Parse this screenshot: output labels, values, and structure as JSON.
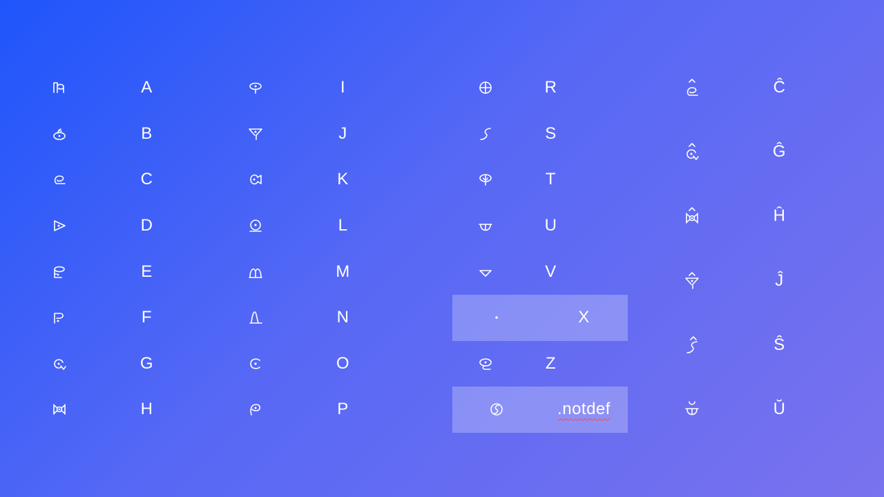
{
  "columns": [
    {
      "pairs": [
        {
          "icon": "script-glyph-a-icon",
          "letter": "A"
        },
        {
          "icon": "script-glyph-b-icon",
          "letter": "B"
        },
        {
          "icon": "script-glyph-c-icon",
          "letter": "C"
        },
        {
          "icon": "script-glyph-d-icon",
          "letter": "D"
        },
        {
          "icon": "script-glyph-e-icon",
          "letter": "E"
        },
        {
          "icon": "script-glyph-f-icon",
          "letter": "F"
        },
        {
          "icon": "script-glyph-g-icon",
          "letter": "G"
        },
        {
          "icon": "script-glyph-h-icon",
          "letter": "H"
        }
      ]
    },
    {
      "pairs": [
        {
          "icon": "script-glyph-i-icon",
          "letter": "I"
        },
        {
          "icon": "script-glyph-j-icon",
          "letter": "J"
        },
        {
          "icon": "script-glyph-k-icon",
          "letter": "K"
        },
        {
          "icon": "script-glyph-l-icon",
          "letter": "L"
        },
        {
          "icon": "script-glyph-m-icon",
          "letter": "M"
        },
        {
          "icon": "script-glyph-n-icon",
          "letter": "N"
        },
        {
          "icon": "script-glyph-o-icon",
          "letter": "O"
        },
        {
          "icon": "script-glyph-p-icon",
          "letter": "P"
        }
      ]
    },
    {
      "pairs": [
        {
          "icon": "script-glyph-r-icon",
          "letter": "R"
        },
        {
          "icon": "script-glyph-s-icon",
          "letter": "S"
        },
        {
          "icon": "script-glyph-t-icon",
          "letter": "T"
        },
        {
          "icon": "script-glyph-u-icon",
          "letter": "U"
        },
        {
          "icon": "script-glyph-v-icon",
          "letter": "V"
        },
        {
          "icon": "script-glyph-x-icon",
          "letter": "X",
          "highlighted": true
        },
        {
          "icon": "script-glyph-z-icon",
          "letter": "Z"
        },
        {
          "icon": "script-glyph-notdef-icon",
          "letter": ".notdef",
          "highlighted": true
        }
      ]
    },
    {
      "pairs": [
        {
          "icon": "script-glyph-ccirc-icon",
          "letter": "Ĉ"
        },
        {
          "icon": "script-glyph-gcirc-icon",
          "letter": "Ĝ"
        },
        {
          "icon": "script-glyph-hcirc-icon",
          "letter": "Ĥ"
        },
        {
          "icon": "script-glyph-jcirc-icon",
          "letter": "Ĵ"
        },
        {
          "icon": "script-glyph-scirc-icon",
          "letter": "Ŝ"
        },
        {
          "icon": "script-glyph-ubreve-icon",
          "letter": "Ŭ"
        }
      ]
    }
  ],
  "colors": {
    "gradient_start": "#1f55fb",
    "gradient_end": "#7a72ee",
    "highlight": "rgba(255,255,255,0.25)",
    "text": "#ffffff"
  }
}
